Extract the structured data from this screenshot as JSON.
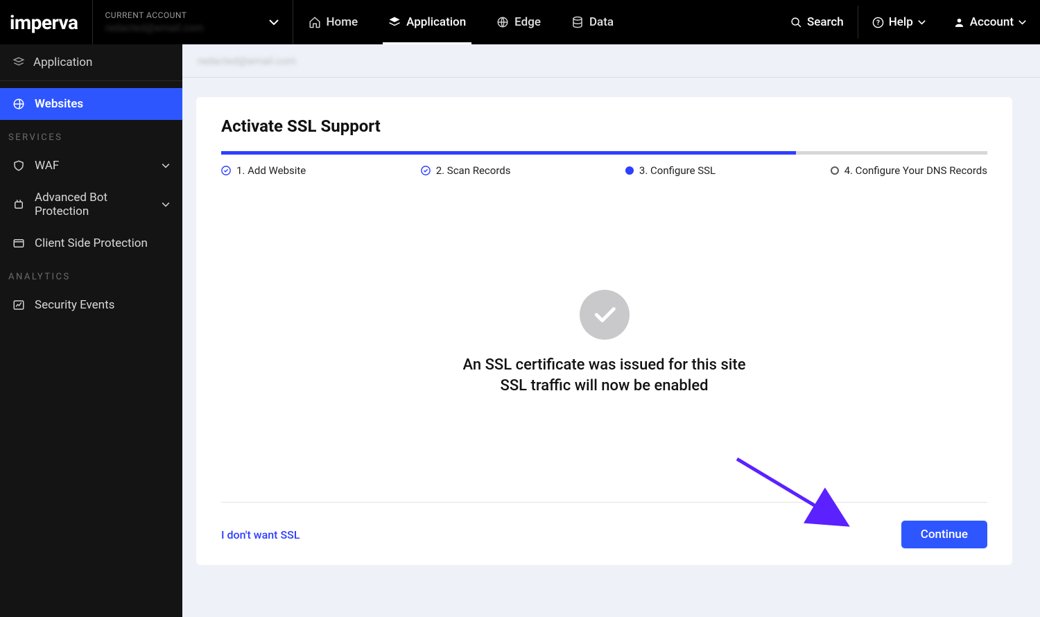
{
  "brand": "imperva",
  "account_selector": {
    "label": "CURRENT ACCOUNT",
    "value": "redacted@email.com"
  },
  "topnav": {
    "home": "Home",
    "application": "Application",
    "edge": "Edge",
    "data": "Data",
    "search": "Search",
    "help": "Help",
    "account": "Account"
  },
  "sidebar": {
    "application": "Application",
    "websites": "Websites",
    "section_services": "SERVICES",
    "waf": "WAF",
    "abp": "Advanced Bot Protection",
    "csp": "Client Side Protection",
    "section_analytics": "ANALYTICS",
    "sec_events": "Security Events"
  },
  "breadcrumb_masked": "redacted@email.com",
  "card": {
    "title": "Activate SSL Support",
    "steps": {
      "s1": "1. Add Website",
      "s2": "2. Scan Records",
      "s3": "3. Configure SSL",
      "s4": "4. Configure Your DNS Records"
    },
    "msg1": "An SSL certificate was issued for this site",
    "msg2": "SSL traffic will now be enabled",
    "link_no_ssl": "I don't want SSL",
    "btn_continue": "Continue"
  },
  "colors": {
    "accent_blue": "#2e56ff",
    "step_blue": "#2e3fff",
    "annotation": "#5b21ff"
  }
}
